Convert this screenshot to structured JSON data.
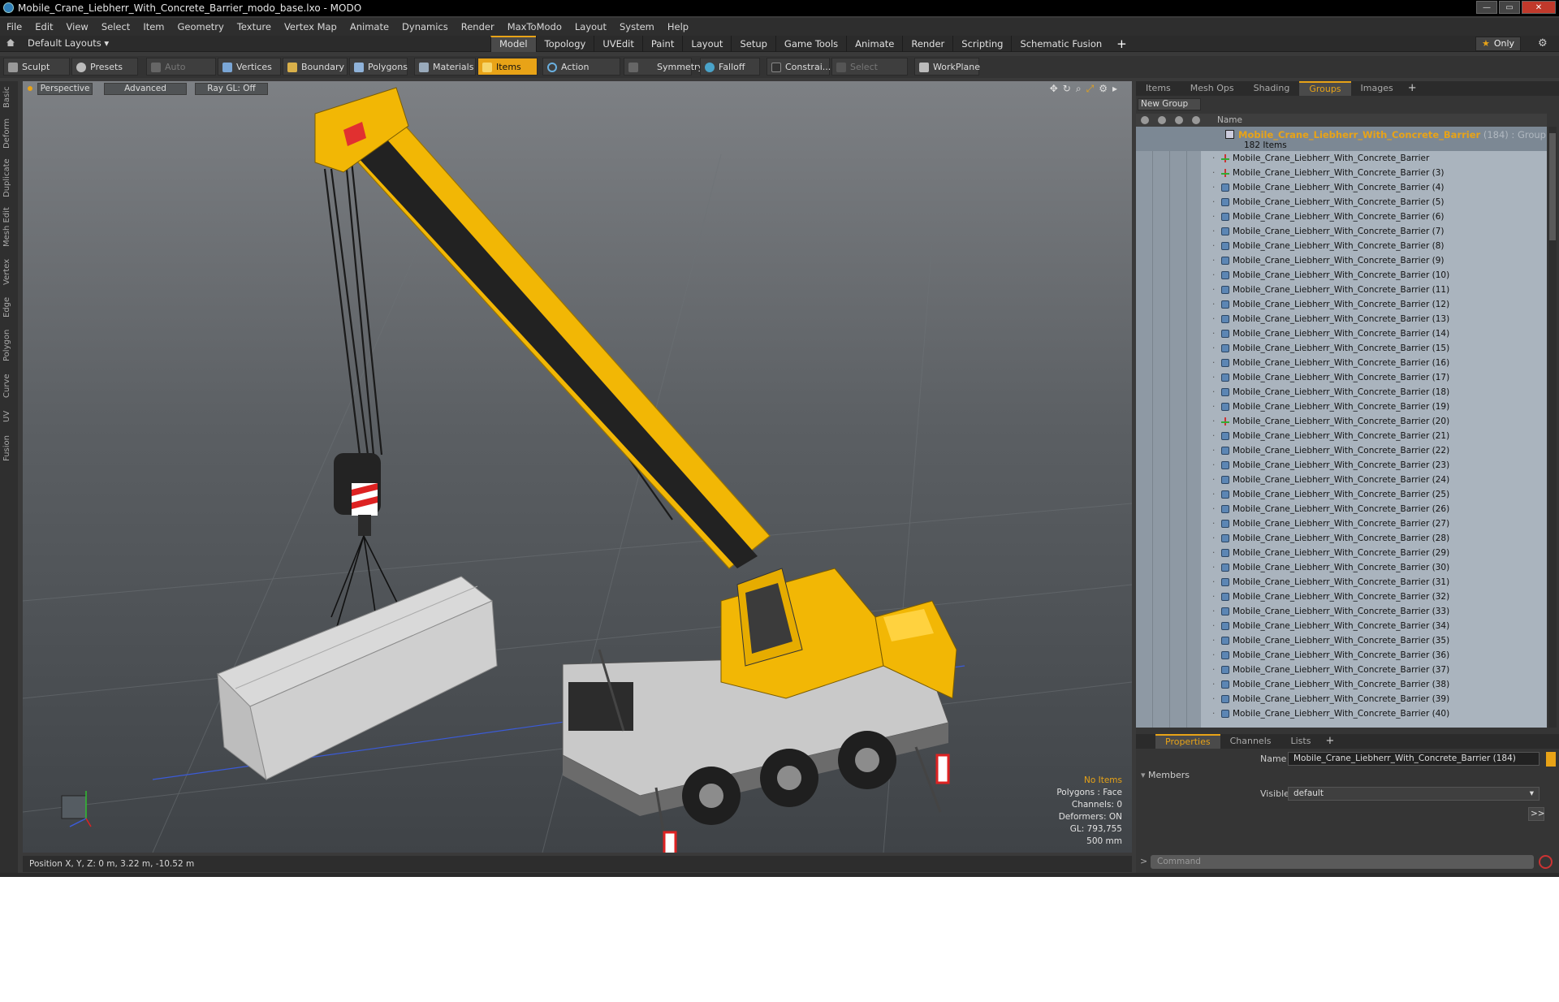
{
  "window": {
    "title": "Mobile_Crane_Liebherr_With_Concrete_Barrier_modo_base.lxo - MODO",
    "min_label": "—",
    "max_label": "▭",
    "close_label": "✕"
  },
  "menu": [
    "File",
    "Edit",
    "View",
    "Select",
    "Item",
    "Geometry",
    "Texture",
    "Vertex Map",
    "Animate",
    "Dynamics",
    "Render",
    "MaxToModo",
    "Layout",
    "System",
    "Help"
  ],
  "layout": {
    "dropdown": "Default Layouts ▾",
    "tabs": [
      "Model",
      "Topology",
      "UVEdit",
      "Paint",
      "Layout",
      "Setup",
      "Game Tools",
      "Animate",
      "Render",
      "Scripting",
      "Schematic Fusion"
    ],
    "active_tab": "Model",
    "plus": "+",
    "only": "Only",
    "only_star": "★",
    "gear": "⚙"
  },
  "toolbar": {
    "sculpt": "Sculpt",
    "presets": "Presets",
    "auto_select": "Auto Select",
    "vertices": "Vertices",
    "boundary": "Boundary",
    "polygons": "Polygons",
    "materials": "Materials",
    "items": "Items",
    "action_center": "Action Center",
    "symmetry": "Symmetry",
    "falloff": "Falloff",
    "constraints": "Constrai...",
    "select_through": "Select Through",
    "workplane": "WorkPlane"
  },
  "left_tabs": [
    "Basic",
    "Deform",
    "Duplicate",
    "Mesh Edit",
    "Vertex",
    "Edge",
    "Polygon",
    "Curve",
    "UV",
    "Fusion"
  ],
  "viewport": {
    "perspective": "Perspective",
    "advanced": "Advanced",
    "raygl": "Ray GL: Off",
    "info": {
      "no_items": "No Items",
      "polygons": "Polygons : Face",
      "channels": "Channels: 0",
      "deformers": "Deformers: ON",
      "gl": "GL: 793,755",
      "scale": "500 mm"
    }
  },
  "status": {
    "position": "Position X, Y, Z:   0 m, 3.22 m, -10.52 m"
  },
  "right_panel": {
    "tabs": [
      "Items",
      "Mesh Ops",
      "Shading",
      "Groups",
      "Images"
    ],
    "active_tab": "Groups",
    "plus": "+",
    "new_group": "New Group",
    "name_header": "Name",
    "group": {
      "name": "Mobile_Crane_Liebherr_With_Concrete_Barrier",
      "meta": " (184) : Group",
      "count": "182 Items"
    },
    "items": [
      "Mobile_Crane_Liebherr_With_Concrete_Barrier",
      "Mobile_Crane_Liebherr_With_Concrete_Barrier (3)",
      "Mobile_Crane_Liebherr_With_Concrete_Barrier (4)",
      "Mobile_Crane_Liebherr_With_Concrete_Barrier (5)",
      "Mobile_Crane_Liebherr_With_Concrete_Barrier (6)",
      "Mobile_Crane_Liebherr_With_Concrete_Barrier (7)",
      "Mobile_Crane_Liebherr_With_Concrete_Barrier (8)",
      "Mobile_Crane_Liebherr_With_Concrete_Barrier (9)",
      "Mobile_Crane_Liebherr_With_Concrete_Barrier (10)",
      "Mobile_Crane_Liebherr_With_Concrete_Barrier (11)",
      "Mobile_Crane_Liebherr_With_Concrete_Barrier (12)",
      "Mobile_Crane_Liebherr_With_Concrete_Barrier (13)",
      "Mobile_Crane_Liebherr_With_Concrete_Barrier (14)",
      "Mobile_Crane_Liebherr_With_Concrete_Barrier (15)",
      "Mobile_Crane_Liebherr_With_Concrete_Barrier (16)",
      "Mobile_Crane_Liebherr_With_Concrete_Barrier (17)",
      "Mobile_Crane_Liebherr_With_Concrete_Barrier (18)",
      "Mobile_Crane_Liebherr_With_Concrete_Barrier (19)",
      "Mobile_Crane_Liebherr_With_Concrete_Barrier (20)",
      "Mobile_Crane_Liebherr_With_Concrete_Barrier (21)",
      "Mobile_Crane_Liebherr_With_Concrete_Barrier (22)",
      "Mobile_Crane_Liebherr_With_Concrete_Barrier (23)",
      "Mobile_Crane_Liebherr_With_Concrete_Barrier (24)",
      "Mobile_Crane_Liebherr_With_Concrete_Barrier (25)",
      "Mobile_Crane_Liebherr_With_Concrete_Barrier (26)",
      "Mobile_Crane_Liebherr_With_Concrete_Barrier (27)",
      "Mobile_Crane_Liebherr_With_Concrete_Barrier (28)",
      "Mobile_Crane_Liebherr_With_Concrete_Barrier (29)",
      "Mobile_Crane_Liebherr_With_Concrete_Barrier (30)",
      "Mobile_Crane_Liebherr_With_Concrete_Barrier (31)",
      "Mobile_Crane_Liebherr_With_Concrete_Barrier (32)",
      "Mobile_Crane_Liebherr_With_Concrete_Barrier (33)",
      "Mobile_Crane_Liebherr_With_Concrete_Barrier (34)",
      "Mobile_Crane_Liebherr_With_Concrete_Barrier (35)",
      "Mobile_Crane_Liebherr_With_Concrete_Barrier (36)",
      "Mobile_Crane_Liebherr_With_Concrete_Barrier (37)",
      "Mobile_Crane_Liebherr_With_Concrete_Barrier (38)",
      "Mobile_Crane_Liebherr_With_Concrete_Barrier (39)",
      "Mobile_Crane_Liebherr_With_Concrete_Barrier (40)"
    ]
  },
  "properties": {
    "tabs": [
      "Properties",
      "Channels",
      "Lists"
    ],
    "active_tab": "Properties",
    "plus": "+",
    "name_label": "Name",
    "name_value": "Mobile_Crane_Liebherr_With_Concrete_Barrier (184)",
    "members": "Members",
    "visible_label": "Visible",
    "visible_value": "default",
    "expand": ">>"
  },
  "command": {
    "placeholder": "Command",
    "arrow": ">"
  },
  "colors": {
    "accent": "#e8a317",
    "crane_yellow": "#f2b705",
    "list_bg": "#aab4be"
  }
}
